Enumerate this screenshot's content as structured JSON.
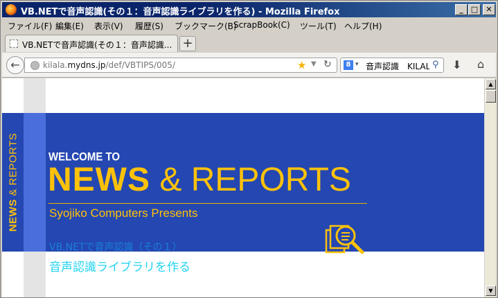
{
  "window": {
    "title": "VB.NETで音声認識(その１：音声認識ライブラリを作る) - Mozilla Firefox",
    "min_glyph": "_",
    "max_glyph": "□",
    "close_glyph": "✕"
  },
  "menu": {
    "items": [
      "ファイル(F)",
      "編集(E)",
      "表示(V)",
      "履歴(S)",
      "ブックマーク(B)",
      "ScrapBook(C)",
      "ツール(T)",
      "ヘルプ(H)"
    ]
  },
  "tabs": [
    {
      "label": "VB.NETで音声認識(その１：音声認識..."
    }
  ],
  "newtab_glyph": "+",
  "nav": {
    "back_glyph": "←",
    "url_host": "kilala.",
    "url_domain": "mydns.jp",
    "url_path": "/def/VBTIPS/005/",
    "star_glyph": "★",
    "reload_glyph": "↻",
    "search_engine_letter": "8",
    "search_query": "音声認識　KILALA",
    "download_glyph": "⬇",
    "home_glyph": "⌂"
  },
  "page": {
    "vertical_news": "NEWS",
    "vertical_rest": " & REPORTS",
    "welcome": "WELCOME TO",
    "headline_news": "NEWS",
    "headline_rest": " & REPORTS",
    "subtitle": "Syojiko Computers Presents",
    "link_primary": "VB.NETで音声認識（その１）",
    "link_secondary": "音声認識ライブラリを作る"
  },
  "colors": {
    "band": "#2447b1",
    "accent": "#ffc20a",
    "link": "#1a7fd9",
    "link_secondary": "#22d3f0"
  }
}
